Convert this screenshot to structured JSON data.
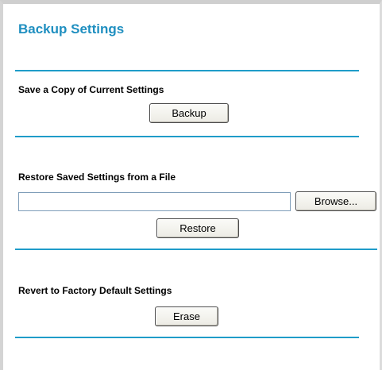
{
  "page_title": "Backup Settings",
  "backup_section": {
    "heading": "Save a Copy of Current Settings",
    "backup_button": "Backup"
  },
  "restore_section": {
    "heading": "Restore Saved Settings from a File",
    "file_path_value": "",
    "browse_button": "Browse...",
    "restore_button": "Restore"
  },
  "erase_section": {
    "heading": "Revert to Factory Default Settings",
    "erase_button": "Erase"
  },
  "colors": {
    "title": "#1f8fc0",
    "divider": "#1f9cc9"
  }
}
